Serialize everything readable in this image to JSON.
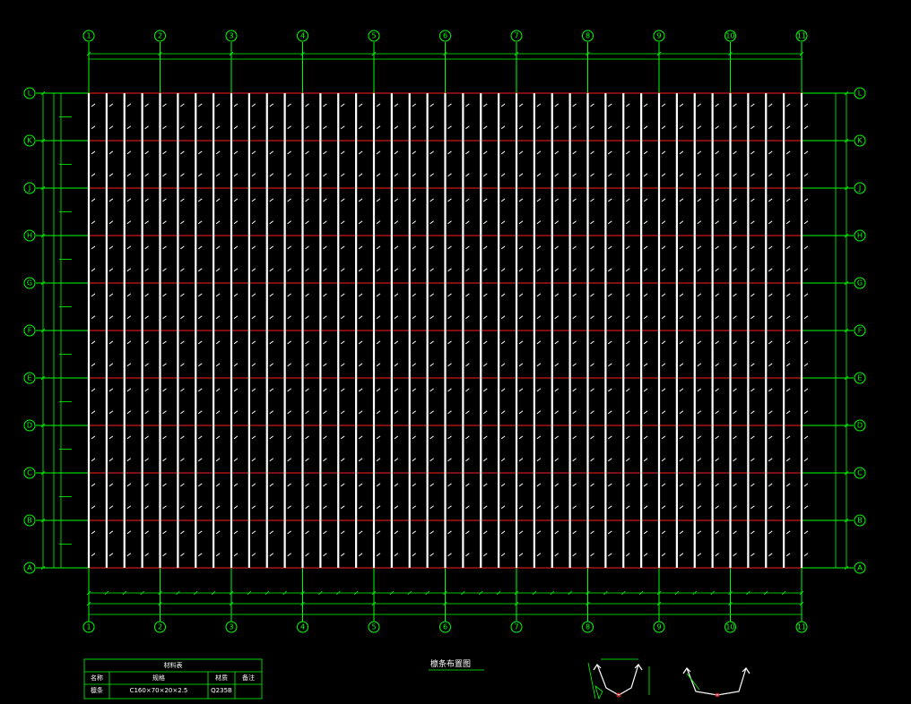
{
  "colors": {
    "background": "#000000",
    "grid": "#00ff00",
    "beam": "#ff2020",
    "purlin": "#ffffff"
  },
  "axes": {
    "columns": [
      "1",
      "2",
      "3",
      "4",
      "5",
      "6",
      "7",
      "8",
      "9",
      "10",
      "11"
    ],
    "rows": [
      "A",
      "B",
      "C",
      "D",
      "E",
      "F",
      "G",
      "H",
      "J",
      "K",
      "L"
    ]
  },
  "drawing_title": "檩条布置图",
  "table": {
    "title": "材料表",
    "headers": [
      "名称",
      "规格",
      "材质",
      "备注"
    ],
    "row": [
      "檩条",
      "C160×70×20×2.5",
      "Q235B",
      ""
    ]
  }
}
